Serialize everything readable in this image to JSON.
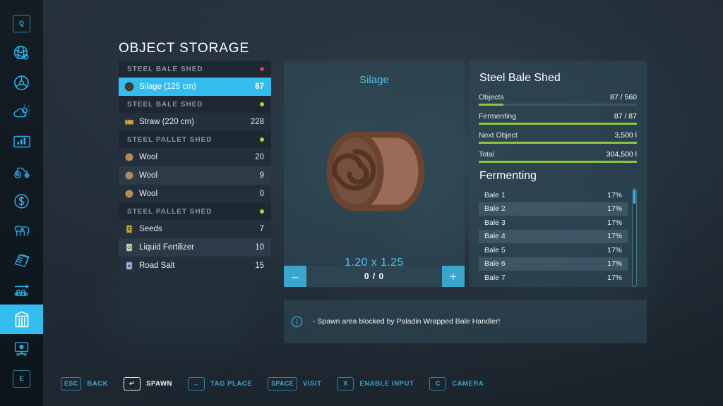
{
  "page": {
    "title": "OBJECT STORAGE"
  },
  "sidebar": {
    "active_index": 10,
    "items": [
      {
        "name": "sidebar-item-quests",
        "icon": "q-key-icon",
        "label": "Q"
      },
      {
        "name": "sidebar-item-map",
        "icon": "globe-icon",
        "label": ""
      },
      {
        "name": "sidebar-item-vehicles",
        "icon": "steering-wheel-icon",
        "label": ""
      },
      {
        "name": "sidebar-item-weather",
        "icon": "weather-icon",
        "label": ""
      },
      {
        "name": "sidebar-item-statistics",
        "icon": "bar-chart-icon",
        "label": ""
      },
      {
        "name": "sidebar-item-machines",
        "icon": "tractor-icon",
        "label": ""
      },
      {
        "name": "sidebar-item-finances",
        "icon": "dollar-icon",
        "label": ""
      },
      {
        "name": "sidebar-item-animals",
        "icon": "cow-icon",
        "label": ""
      },
      {
        "name": "sidebar-item-contracts",
        "icon": "documents-icon",
        "label": ""
      },
      {
        "name": "sidebar-item-production",
        "icon": "conveyor-icon",
        "label": ""
      },
      {
        "name": "sidebar-item-storage",
        "icon": "storage-shed-icon",
        "label": ""
      },
      {
        "name": "sidebar-item-gallery",
        "icon": "easel-icon",
        "label": ""
      },
      {
        "name": "sidebar-item-exit",
        "icon": "e-key-icon",
        "label": "E"
      }
    ]
  },
  "storage_list": [
    {
      "type": "group",
      "label": "STEEL BALE SHED",
      "status_color": "#e03a3a"
    },
    {
      "type": "item",
      "label": "Silage (125 cm)",
      "value": "87",
      "icon": "silage-bale-icon",
      "selected": true
    },
    {
      "type": "group",
      "label": "STEEL BALE SHED",
      "status_color": "#a8d23c"
    },
    {
      "type": "item",
      "label": "Straw (220 cm)",
      "value": "228",
      "icon": "straw-bale-icon"
    },
    {
      "type": "group",
      "label": "STEEL PALLET SHED",
      "status_color": "#a8d23c"
    },
    {
      "type": "item",
      "label": "Wool",
      "value": "20",
      "icon": "wool-pallet-icon"
    },
    {
      "type": "item",
      "label": "Wool",
      "value": "9",
      "icon": "wool-pallet-icon"
    },
    {
      "type": "item",
      "label": "Wool",
      "value": "0",
      "icon": "wool-pallet-icon"
    },
    {
      "type": "group",
      "label": "STEEL PALLET SHED",
      "status_color": "#a8d23c"
    },
    {
      "type": "item",
      "label": "Seeds",
      "value": "7",
      "icon": "seeds-pallet-icon"
    },
    {
      "type": "item",
      "label": "Liquid Fertilizer",
      "value": "10",
      "icon": "liquid-fertilizer-pallet-icon"
    },
    {
      "type": "item",
      "label": "Road Salt",
      "value": "15",
      "icon": "road-salt-pallet-icon"
    }
  ],
  "preview": {
    "title": "Silage",
    "dimensions": "1.20 x 1.25",
    "icon": "silage-bale-large-icon",
    "counter": {
      "value": "0 / 0",
      "decrement_label": "–",
      "increment_label": "+"
    }
  },
  "info": {
    "heading": "Steel Bale Shed",
    "stats": [
      {
        "label": "Objects",
        "value": "87 / 560",
        "percent": 15.5
      },
      {
        "label": "Fermenting",
        "value": "87 / 87",
        "percent": 100
      },
      {
        "label": "Next Object",
        "value": "3,500 l",
        "percent": 100
      },
      {
        "label": "Total",
        "value": "304,500 l",
        "percent": 100
      }
    ],
    "fermenting_heading": "Fermenting",
    "fermenting_rows": [
      {
        "label": "Bale 1",
        "value": "17%"
      },
      {
        "label": "Bale 2",
        "value": "17%"
      },
      {
        "label": "Bale 3",
        "value": "17%"
      },
      {
        "label": "Bale 4",
        "value": "17%"
      },
      {
        "label": "Bale 5",
        "value": "17%"
      },
      {
        "label": "Bale 6",
        "value": "17%"
      },
      {
        "label": "Bale 7",
        "value": "17%"
      }
    ]
  },
  "notification": {
    "icon": "info-icon",
    "message": "- Spawn area blocked by Paladin Wrapped Bale Handler!"
  },
  "hotkeys": [
    {
      "key": "ESC",
      "label": "BACK",
      "highlighted": false
    },
    {
      "key": "↵",
      "label": "SPAWN",
      "highlighted": true
    },
    {
      "key": "↔",
      "label": "TAG PLACE",
      "highlighted": false
    },
    {
      "key": "SPACE",
      "label": "VISIT",
      "highlighted": false
    },
    {
      "key": "X",
      "label": "ENABLE INPUT",
      "highlighted": false
    },
    {
      "key": "C",
      "label": "CAMERA",
      "highlighted": false
    }
  ],
  "colors": {
    "accent": "#32bdee",
    "progress_green": "#8cc63f",
    "status_red": "#e03a3a",
    "status_green": "#a8d23c"
  }
}
